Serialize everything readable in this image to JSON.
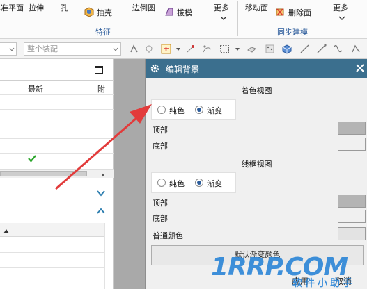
{
  "ribbon": {
    "row1": [
      {
        "id": "datum-plane",
        "label": "基准平面"
      },
      {
        "id": "extrude",
        "label": "拉伸"
      },
      {
        "id": "hole",
        "label": "孔"
      },
      {
        "id": "shell",
        "label": "抽壳"
      },
      {
        "id": "edge-blend",
        "label": "边倒圆"
      },
      {
        "id": "draft",
        "label": "拔模"
      },
      {
        "id": "more-feature",
        "label": "更多"
      },
      {
        "id": "move-face",
        "label": "移动面"
      },
      {
        "id": "delete-face",
        "label": "删除面"
      },
      {
        "id": "more-sync",
        "label": "更多"
      }
    ],
    "group_feature": "特征",
    "group_sync": "同步建模"
  },
  "toolbar": {
    "combo_right_placeholder": "整个装配"
  },
  "navigator": {
    "header_latest": "最新",
    "header_attach": "附"
  },
  "dialog": {
    "title": "编辑背景",
    "shaded": {
      "title": "着色视图",
      "option_plain": "纯色",
      "option_gradient": "渐变",
      "selected": "渐变",
      "top_label": "顶部",
      "bottom_label": "底部",
      "top_color": "#b4b4b4",
      "bottom_color": "#f0f0f0"
    },
    "wireframe": {
      "title": "线框视图",
      "option_plain": "纯色",
      "option_gradient": "渐变",
      "selected": "渐变",
      "top_label": "顶部",
      "bottom_label": "底部",
      "top_color": "#b4b4b4",
      "bottom_color": "#f0f0f0"
    },
    "normal_color_label": "普通颜色",
    "normal_color": "#e3e3e3",
    "default_gradient_button": "默认渐变颜色",
    "apply_button": "应用",
    "cancel_button": "取消"
  },
  "watermark": {
    "brand": "1RRP.COM",
    "sub": "软件小助手"
  },
  "colors": {
    "dialog_title_bg": "#3b6f8e",
    "gap_gray": "#a9a9a9",
    "annotation_arrow": "#e23b3b",
    "check_green": "#2aa52a"
  }
}
